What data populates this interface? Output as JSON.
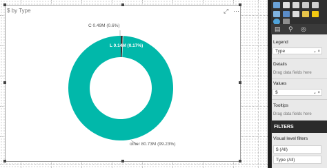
{
  "visual": {
    "title": "$ by Type",
    "focus_icon": "⤢",
    "more_icon": "⋯"
  },
  "chart_data": {
    "type": "pie",
    "donut": true,
    "categories": [
      "C",
      "L",
      "other"
    ],
    "values": [
      0.49,
      0.14,
      80.73
    ],
    "value_unit": "M",
    "labels": [
      "C 0.49M (0.6%)",
      "L 0.14M (0.17%)",
      "other 80.73M (99.23%)"
    ],
    "colors": [
      "#333333",
      "#e8e8e8",
      "#01b8aa"
    ]
  },
  "panel": {
    "legend_label": "Legend",
    "legend_field": "Type",
    "details_label": "Details",
    "details_placeholder": "Drag data fields here",
    "values_label": "Values",
    "values_field": "$",
    "tooltips_label": "Tooltips",
    "tooltips_placeholder": "Drag data fields here",
    "filters_title": "FILTERS",
    "visual_filters_label": "Visual level filters",
    "filter_1": "$ (All)",
    "filter_2": "Type (All)",
    "remove_icon": "×",
    "dropdown_icon": "⌄"
  }
}
